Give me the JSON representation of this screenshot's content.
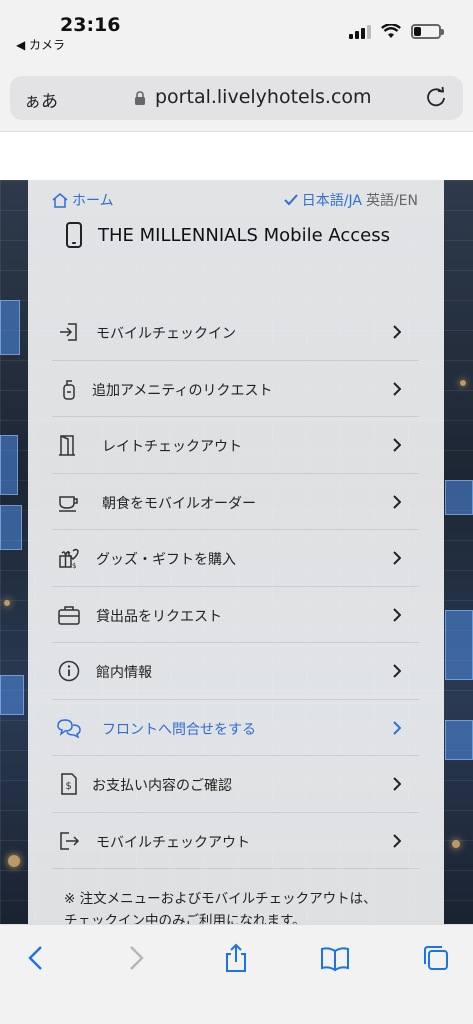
{
  "status_bar": {
    "time": "23:16",
    "back_label": "◀ カメラ"
  },
  "browser": {
    "text_size_label": "ぁあ",
    "url": "portal.livelyhotels.com"
  },
  "topnav": {
    "home_label": "ホーム",
    "lang_current": "日本語/JA",
    "lang_other": "英語/EN"
  },
  "page": {
    "title": "THE MILLENNIALS Mobile Access"
  },
  "menu": {
    "items": [
      {
        "label": "モバイルチェックイン",
        "icon": "enter-icon"
      },
      {
        "label": "追加アメニティのリクエスト",
        "icon": "amenity-bottle-icon"
      },
      {
        "label": "レイトチェックアウト",
        "icon": "door-icon"
      },
      {
        "label": "朝食をモバイルオーダー",
        "icon": "coffee-cup-icon"
      },
      {
        "label": "グッズ・ギフトを購入",
        "icon": "gift-icon"
      },
      {
        "label": "貸出品をリクエスト",
        "icon": "briefcase-icon"
      },
      {
        "label": "館内情報",
        "icon": "info-icon"
      },
      {
        "label": "フロントへ問合せをする",
        "icon": "chat-icon"
      },
      {
        "label": "お支払い内容のご確認",
        "icon": "receipt-icon"
      },
      {
        "label": "モバイルチェックアウト",
        "icon": "exit-icon"
      }
    ]
  },
  "note": {
    "line1": "※ 注文メニューおよびモバイルチェックアウトは、",
    "line2": "チェックイン中のみご利用になれます。"
  },
  "colors": {
    "accent": "#2f6fd6",
    "ios_blue": "#1a73e8"
  }
}
